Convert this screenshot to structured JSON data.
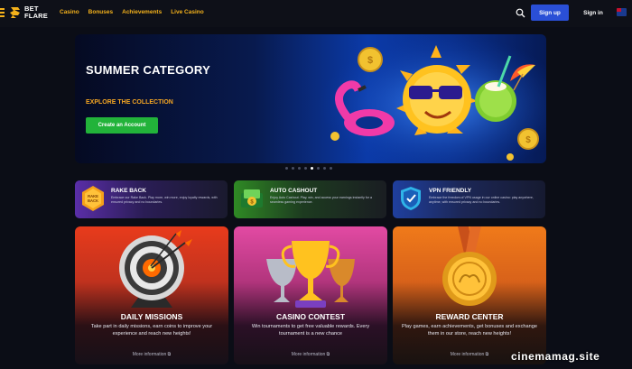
{
  "brand": {
    "logo_line1": "BET",
    "logo_line2": "FLARE",
    "accent": "#f5b21b"
  },
  "nav": {
    "items": [
      "Casino",
      "Bonuses",
      "Achievements",
      "Live Casino"
    ],
    "signup_label": "Sign up",
    "signin_label": "Sign in"
  },
  "icons": [
    "menu-icon",
    "search-icon",
    "flag-icon",
    "coin-icon",
    "sun-icon",
    "flamingo-icon",
    "coconut-icon",
    "umbrella-icon",
    "target-icon",
    "trophy-icon",
    "medal-icon",
    "external-link-icon"
  ],
  "hero": {
    "title": "SUMMER CATEGORY",
    "subtitle": "EXPLORE THE COLLECTION",
    "button_label": "Create an Account",
    "slides_total": 8,
    "slide_active": 5
  },
  "features": [
    {
      "title": "RAKE BACK",
      "badge_text": "RAKE BACK",
      "description": "Embrace our Rake Back. Play more, win more, enjoy loyalty rewards, with ensured privacy and no boundaries."
    },
    {
      "title": "AUTO CASHOUT",
      "description": "Enjoy Auto Cashout. Play, win, and access your earnings instantly for a seamless gaming experience."
    },
    {
      "title": "VPN FRIENDLY",
      "description": "Embrace the freedom of VPN usage in our online casino: play anywhere, anytime, with ensured privacy and no boundaries."
    }
  ],
  "cards": [
    {
      "title": "DAILY MISSIONS",
      "description": "Take part in daily missions, earn coins to improve your experience and reach new heights!",
      "link": "More information"
    },
    {
      "title": "CASINO CONTEST",
      "description": "Win tournaments to get free valuable rewards. Every tournament is a new chance",
      "link": "More information"
    },
    {
      "title": "REWARD CENTER",
      "description": "Play games, earn achievements, get bonuses and exchange them in our store, reach new heights!",
      "link": "More information"
    }
  ],
  "watermark": "cinemamag.site",
  "colors": {
    "signup": "#2a4fd6",
    "hero_button": "#22b33a",
    "hero_subtitle": "#f5a623"
  }
}
